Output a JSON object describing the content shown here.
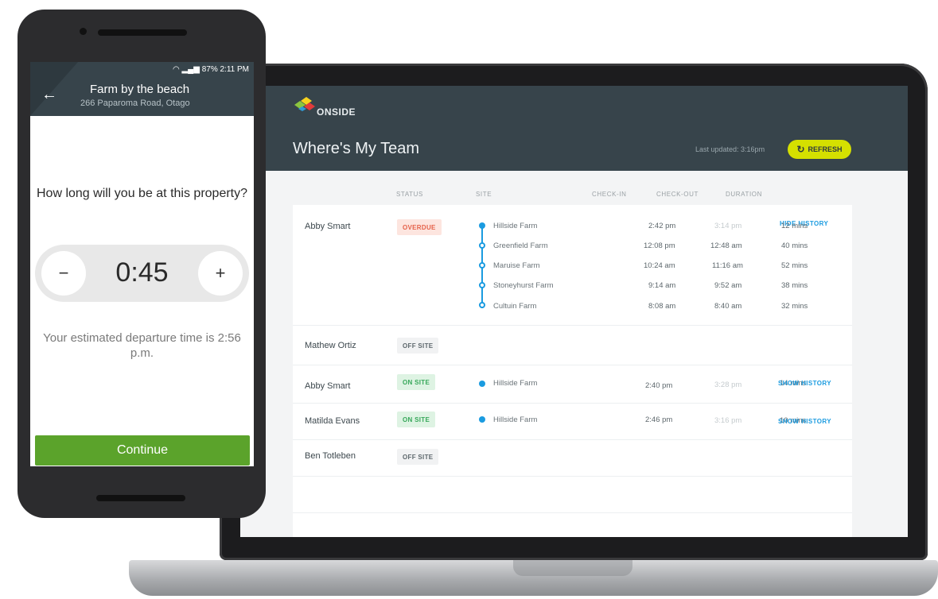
{
  "phone": {
    "status_bar": "87% 2:11 PM",
    "farm_name": "Farm by the beach",
    "farm_address": "266 Paparoma Road, Otago",
    "question": "How long will you be at this property?",
    "duration_value": "0:45",
    "minus_label": "−",
    "plus_label": "+",
    "estimate_text": "Your estimated departure time is 2:56 p.m.",
    "continue_label": "Continue"
  },
  "dashboard": {
    "logo_text": "ONSIDE",
    "title": "Where's My Team",
    "last_updated": "Last updated: 3:16pm",
    "refresh_label": "REFRESH",
    "columns": {
      "status": "STATUS",
      "site": "SITE",
      "check_in": "CHECK-IN",
      "check_out": "CHECK-OUT",
      "duration": "DURATION"
    },
    "rows": [
      {
        "name": "Abby Smart",
        "status": "OVERDUE",
        "action": "HIDE HISTORY",
        "visits": [
          {
            "site": "Hillside Farm",
            "check_in": "2:42 pm",
            "check_out": "3:14 pm",
            "duration": "12 mins"
          },
          {
            "site": "Greenfield Farm",
            "check_in": "12:08 pm",
            "check_out": "12:48 am",
            "duration": "40 mins"
          },
          {
            "site": "Maruise Farm",
            "check_in": "10:24 am",
            "check_out": "11:16 am",
            "duration": "52 mins"
          },
          {
            "site": "Stoneyhurst Farm",
            "check_in": "9:14 am",
            "check_out": "9:52 am",
            "duration": "38 mins"
          },
          {
            "site": "Cultuin Farm",
            "check_in": "8:08 am",
            "check_out": "8:40 am",
            "duration": "32 mins"
          }
        ]
      },
      {
        "name": "Mathew Ortiz",
        "status": "OFF SITE"
      },
      {
        "name": "Abby Smart",
        "status": "ON SITE",
        "action": "SHOW HISTORY",
        "visits": [
          {
            "site": "Hillside Farm",
            "check_in": "2:40 pm",
            "check_out": "3:28 pm",
            "duration": "14 mins"
          }
        ]
      },
      {
        "name": "Matilda Evans",
        "status": "ON SITE",
        "action": "SHOW HISTORY",
        "visits": [
          {
            "site": "Hillside Farm",
            "check_in": "2:46 pm",
            "check_out": "3:16 pm",
            "duration": "10 mins"
          }
        ]
      },
      {
        "name": "Ben Totleben",
        "status": "OFF SITE"
      }
    ]
  },
  "colors": {
    "header": "#37444b",
    "accent": "#d5e000",
    "link": "#1a9be0",
    "continue": "#5ba32b",
    "overdue": "#e5624a",
    "onsite": "#37a85a"
  }
}
